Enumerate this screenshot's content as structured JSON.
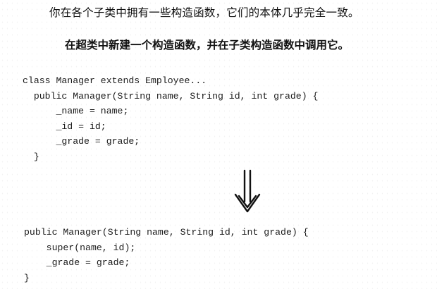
{
  "intro_text": "你在各个子类中拥有一些构造函数，它们的本体几乎完全一致。",
  "refactoring_rule": "在超类中新建一个构造函数，并在子类构造函数中调用它。",
  "code_before": [
    "class Manager extends Employee...",
    "  public Manager(String name, String id, int grade) {",
    "      _name = name;",
    "      _id = id;",
    "      _grade = grade;",
    "  }"
  ],
  "arrow_icon": "double-down-arrow-icon",
  "code_after": [
    "public Manager(String name, String id, int grade) {",
    "    super(name, id);",
    "    _grade = grade;",
    "}"
  ]
}
